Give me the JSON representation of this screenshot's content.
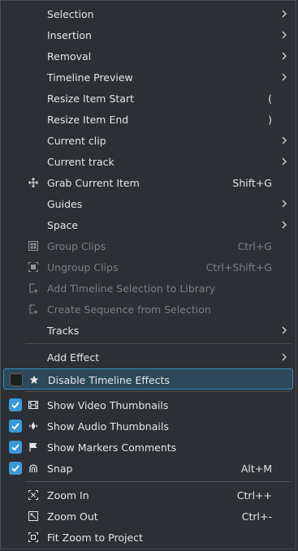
{
  "colors": {
    "background": "#2c3034",
    "highlight": "#2d4858",
    "highlight_border": "#3b8ec0",
    "checkbox_on": "#3a9ad9",
    "disabled_text": "#7b7f84"
  },
  "menu": {
    "items": [
      {
        "label": "Selection",
        "submenu": true
      },
      {
        "label": "Insertion",
        "submenu": true
      },
      {
        "label": "Removal",
        "submenu": true
      },
      {
        "label": "Timeline Preview",
        "submenu": true
      },
      {
        "label": "Resize Item Start",
        "shortcut": "("
      },
      {
        "label": "Resize Item End",
        "shortcut": ")"
      },
      {
        "label": "Current clip",
        "submenu": true
      },
      {
        "label": "Current track",
        "submenu": true
      },
      {
        "label": "Grab Current Item",
        "shortcut": "Shift+G",
        "icon": "move-icon"
      },
      {
        "label": "Guides",
        "submenu": true
      },
      {
        "label": "Space",
        "submenu": true
      },
      {
        "label": "Group Clips",
        "shortcut": "Ctrl+G",
        "icon": "group-icon",
        "disabled": true
      },
      {
        "label": "Ungroup Clips",
        "shortcut": "Ctrl+Shift+G",
        "icon": "ungroup-icon",
        "disabled": true
      },
      {
        "label": "Add Timeline Selection to Library",
        "icon": "add-library-icon",
        "disabled": true
      },
      {
        "label": "Create Sequence from Selection",
        "icon": "add-library-icon",
        "disabled": true
      },
      {
        "label": "Tracks",
        "submenu": true
      },
      {
        "label": "Add Effect",
        "submenu": true
      },
      {
        "label": "Disable Timeline Effects",
        "icon": "star-icon",
        "checkable": true,
        "checked": false,
        "highlighted": true
      },
      {
        "label": "Show Video Thumbnails",
        "icon": "film-icon",
        "checkable": true,
        "checked": true
      },
      {
        "label": "Show Audio Thumbnails",
        "icon": "audio-icon",
        "checkable": true,
        "checked": true
      },
      {
        "label": "Show Markers Comments",
        "icon": "flag-icon",
        "checkable": true,
        "checked": true
      },
      {
        "label": "Snap",
        "shortcut": "Alt+M",
        "icon": "magnet-icon",
        "checkable": true,
        "checked": true
      },
      {
        "label": "Zoom In",
        "shortcut": "Ctrl++",
        "icon": "zoom-in-icon"
      },
      {
        "label": "Zoom Out",
        "shortcut": "Ctrl+-",
        "icon": "zoom-out-icon"
      },
      {
        "label": "Fit Zoom to Project",
        "icon": "zoom-fit-icon"
      }
    ]
  }
}
